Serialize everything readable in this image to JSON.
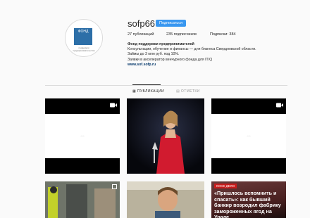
{
  "window": {
    "corner_text": "……………………………………"
  },
  "profile": {
    "avatar_logo_text": "ФОНД",
    "avatar_caption": "поддержки предпринимательства",
    "username": "sofp66",
    "follow_label": "Подписаться",
    "stats": {
      "posts": "27 публикаций",
      "followers": "235 подписчиков",
      "following": "Подписки: 384"
    },
    "bio": {
      "name": "Фонд поддержки предпринимателей",
      "line1": "Консультации, обучение и финансы — для бизнеса Свердловской области.",
      "line2": "Займы до 3 млн руб. под 10%.",
      "line3": "Заявки в акселератор венчурного фонда для IT/Q",
      "link": "www.sof.sofp.ru"
    }
  },
  "tabs": [
    {
      "label": "▦ ПУБЛИКАЦИИ",
      "active": true
    },
    {
      "label": "▤ ОТМЕТКИ",
      "active": false
    }
  ],
  "grid": {
    "video_icon": "video-camera-icon",
    "placeholder_glyph": "◦◦◦",
    "news_tag": "КОСЕ ДЕЛО",
    "news_headline": "«Пришлось вспомнить и спасать»: как бывший банкир возродил фабрику замороженных ягод на Урале"
  }
}
